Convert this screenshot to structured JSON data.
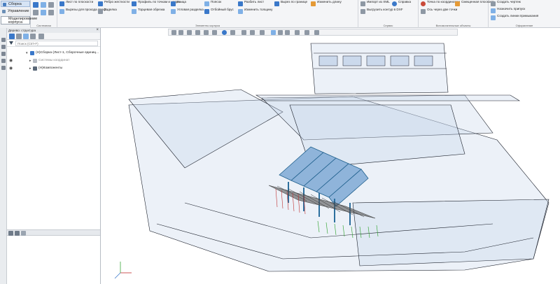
{
  "modes": [
    {
      "label": "Сборка",
      "active": true
    },
    {
      "label": "Управление",
      "active": false
    },
    {
      "label": "Моделирование корпуса",
      "active": false
    }
  ],
  "ribbon": {
    "groups": [
      {
        "footer": "Системная"
      },
      {
        "footer": "Элементы корпуса"
      },
      {
        "footer": "Сервис"
      },
      {
        "footer": "Вспомогательные объекты"
      },
      {
        "footer": "Оформление"
      }
    ],
    "commands": {
      "list_po_ploskosti": "Лист по плоскости",
      "vyrezy": "Вырезы для прохода проф...",
      "rebro": "Ребро жесткости",
      "zadelka": "Заделка",
      "profil": "Профиль по точкам и напра...",
      "torcevaya": "Торцевая обрезка",
      "knica": "Кница",
      "uglovaya": "Угловая разделка",
      "poyasok": "Поясок",
      "otboynyy": "Отбойный брус",
      "razbit": "Разбить лист",
      "izmenit": "Изменить толщину",
      "vyrez_po_granice": "Вырез по границе",
      "izmenit_dlinu": "Изменить длину",
      "import_xml": "Импорт из XML",
      "vygruzit": "Выгрузить контур в DXF",
      "spravka": "Справка",
      "tochka": "Точка по координатам",
      "os": "Ось через две точки",
      "smeshennaya": "Смещенная плоскость",
      "sozdat_chertezh": "Создать чертеж",
      "naznachit": "Назначить припуск",
      "sozdat_linii": "Создать линии примыкания"
    }
  },
  "tree": {
    "title": "Дерево: структура",
    "search_placeholder": "Поиск (Ctrl+F)",
    "items": [
      {
        "label": "(Н)Сборка (Лист-1, Сборочные единиц..."
      },
      {
        "label": "Системы координат"
      },
      {
        "label": "(Н)Компоненты"
      }
    ]
  },
  "colors": {
    "accent": "#3a78c9",
    "hull_line": "#1a1f2a",
    "hull_fill": "#c9d8ec",
    "beam": "#2c6f9e",
    "red_marks": "#c03030",
    "green_marks": "#3aa83a"
  }
}
